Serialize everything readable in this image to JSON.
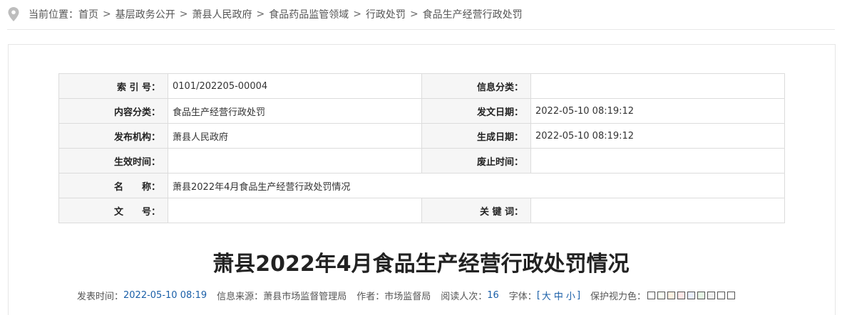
{
  "breadcrumb": {
    "prefix": "当前位置：",
    "items": [
      "首页",
      "基层政务公开",
      "萧县人民政府",
      "食品药品监管领域",
      "行政处罚",
      "食品生产经营行政处罚"
    ],
    "separator": ">"
  },
  "meta": {
    "index_label": "索 引 号：",
    "index_value": "0101/202205-00004",
    "info_category_label": "信息分类：",
    "info_category_value": "",
    "content_category_label": "内容分类：",
    "content_category_value": "食品生产经营行政处罚",
    "issue_date_label": "发文日期：",
    "issue_date_value": "2022-05-10 08:19:12",
    "publisher_label": "发布机构：",
    "publisher_value": "萧县人民政府",
    "generated_date_label": "生成日期：",
    "generated_date_value": "2022-05-10 08:19:12",
    "effective_label": "生效时间：",
    "effective_value": "",
    "expire_label": "废止时间：",
    "expire_value": "",
    "name_label": "名　　称：",
    "name_value": "萧县2022年4月食品生产经营行政处罚情况",
    "doc_no_label": "文　　号：",
    "doc_no_value": "",
    "keywords_label": "关 键 词：",
    "keywords_value": ""
  },
  "article": {
    "title": "萧县2022年4月食品生产经营行政处罚情况"
  },
  "info": {
    "publish_time_label": "发表时间：",
    "publish_time_value": "2022-05-10 08:19",
    "source_label": "信息来源：",
    "source_value": "萧县市场监督管理局",
    "author_label": "作者：",
    "author_value": "市场监督局",
    "reads_label": "阅读人次：",
    "reads_value": "16",
    "font_label": "字体：",
    "font_open": "[",
    "font_large": "大",
    "font_medium": "中",
    "font_small": "小",
    "font_close": "]",
    "eye_label": "保护视力色："
  },
  "swatch_colors": [
    "#ffffff",
    "#fafff4",
    "#fff2e2",
    "#ffe8e8",
    "#eaf0ff",
    "#e6f7e6",
    "#f2f2f2",
    "#ffffff",
    "#ffffff"
  ],
  "colors": {
    "link_blue": "#1a5fa8",
    "label_bg": "#f6f6f6",
    "border": "#dcdcdc"
  }
}
